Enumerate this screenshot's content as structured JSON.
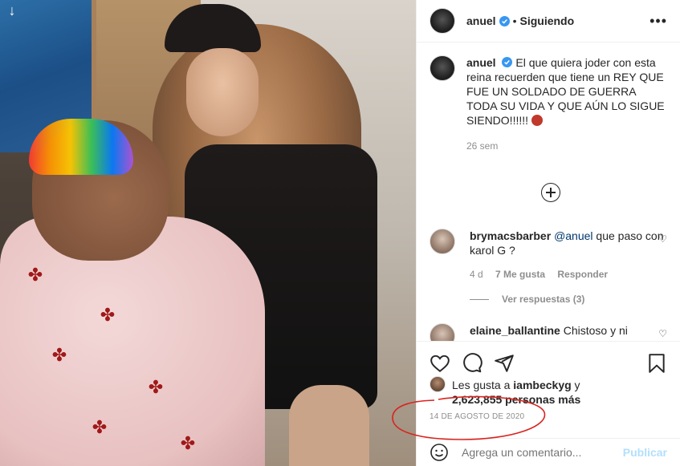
{
  "post": {
    "author": "anuel",
    "follow_status": "Siguiendo",
    "separator": "•",
    "more": "•••",
    "caption_text": "El que quiera joder con esta reina recuerden que tiene un REY QUE FUE UN SOLDADO DE GUERRA TODA SU VIDA Y QUE AÚN LO SIGUE SIENDO!!!!!!",
    "caption_time": "26 sem",
    "date": "14 DE AGOSTO DE 2020"
  },
  "comments": [
    {
      "user": "brymacsbarber",
      "mention": "@anuel",
      "text": " que paso con karol G ?",
      "age": "4 d",
      "likes": "7 Me gusta",
      "reply": "Responder",
      "view_replies": "Ver respuestas (3)"
    },
    {
      "user": "elaine_ballantine",
      "text": "Chistoso y ni"
    }
  ],
  "likes": {
    "prefix": "Les gusta a ",
    "first_user": "iambeckyg",
    "suffix": " y",
    "count": "2,623,855 personas más"
  },
  "composer": {
    "placeholder": "Agrega un comentario...",
    "publish": "Publicar"
  },
  "icons": {
    "like": "heart-icon",
    "comment": "comment-icon",
    "share": "send-icon",
    "save": "bookmark-icon",
    "emoji": "emoji-icon",
    "verified": "verified-badge-icon"
  },
  "colors": {
    "link": "#00376b",
    "muted": "#8e8e8e",
    "publish_disabled": "#b2dffc",
    "verified": "#3897f0",
    "annotation": "#d9231e"
  }
}
